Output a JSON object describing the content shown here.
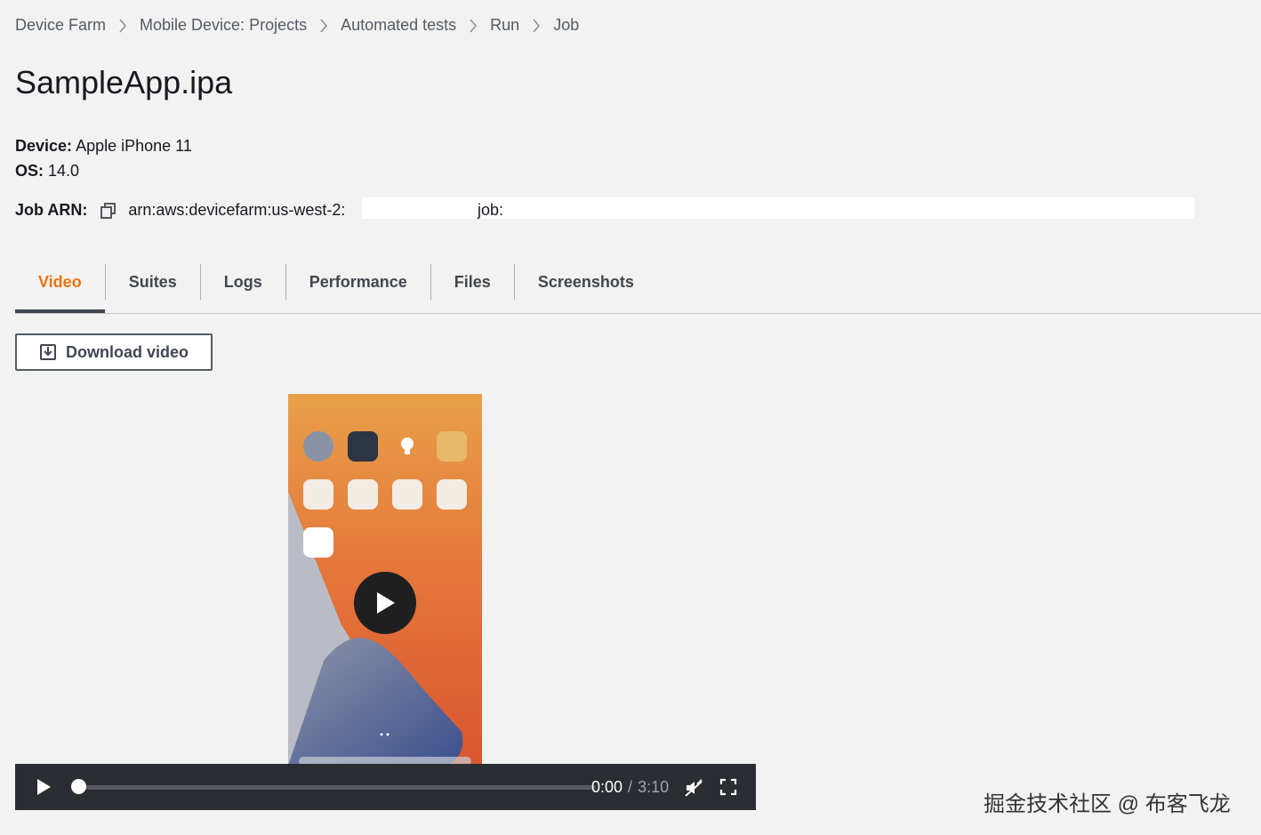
{
  "breadcrumb": {
    "items": [
      "Device Farm",
      "Mobile Device: Projects",
      "Automated tests",
      "Run",
      "Job"
    ]
  },
  "page": {
    "title": "SampleApp.ipa"
  },
  "details": {
    "device_label": "Device:",
    "device_value": "Apple iPhone 11",
    "os_label": "OS:",
    "os_value": "14.0",
    "arn_label": "Job ARN:",
    "arn_value": "arn:aws:devicefarm:us-west-2:",
    "arn_job": "job:"
  },
  "tabs": [
    "Video",
    "Suites",
    "Logs",
    "Performance",
    "Files",
    "Screenshots"
  ],
  "active_tab": "Video",
  "download_button": {
    "label": "Download video",
    "icon": "download-icon"
  },
  "player": {
    "current_time": "0:00",
    "separator": "/",
    "duration": "3:10",
    "progress": 0.0,
    "icons": [
      "play-icon",
      "mute-icon",
      "fullscreen-icon",
      "big-play-icon"
    ]
  },
  "watermark": "掘金技术社区 @ 布客飞龙",
  "colors": {
    "accent": "#ec7211",
    "background": "#f2f2f2",
    "player_bar": "#2a2d31",
    "text": "#16191f"
  }
}
